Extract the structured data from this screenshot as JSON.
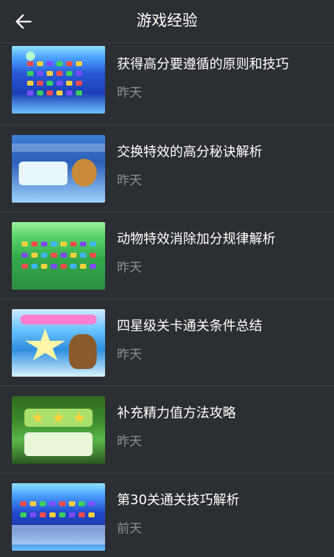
{
  "header": {
    "title": "游戏经验"
  },
  "list": {
    "items": [
      {
        "title": "获得高分要遵循的原则和技巧",
        "date": "昨天",
        "thumb": "board-thumbnail"
      },
      {
        "title": "交换特效的高分秘诀解析",
        "date": "昨天",
        "thumb": "dialog-thumbnail"
      },
      {
        "title": "动物特效消除加分规律解析",
        "date": "昨天",
        "thumb": "board-green-thumbnail"
      },
      {
        "title": "四星级关卡通关条件总结",
        "date": "昨天",
        "thumb": "card-thumbnail"
      },
      {
        "title": "补充精力值方法攻略",
        "date": "昨天",
        "thumb": "stars-thumbnail"
      },
      {
        "title": "第30关通关技巧解析",
        "date": "前天",
        "thumb": "board-thumbnail"
      }
    ]
  },
  "colors": {
    "background": "#2b2e32",
    "divider": "#3a3e43",
    "title_text": "#ffffff",
    "date_text": "#8b8f93"
  }
}
